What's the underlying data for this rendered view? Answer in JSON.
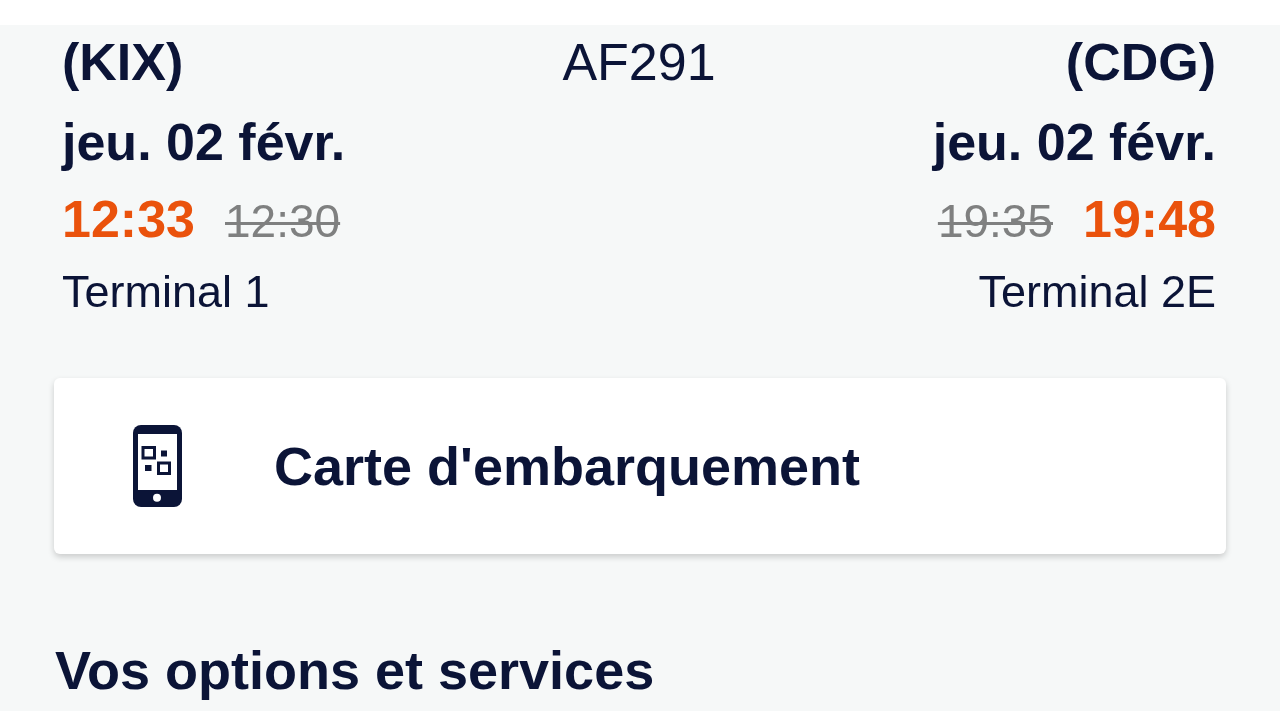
{
  "flight": {
    "origin": {
      "code": "(KIX)",
      "date": "jeu. 02 févr.",
      "times": [
        {
          "time": "12:33",
          "kind": "actual"
        },
        {
          "time": "12:30",
          "kind": "scheduled"
        }
      ],
      "terminal": "Terminal 1"
    },
    "number": "AF291",
    "destination": {
      "code": "(CDG)",
      "date": "jeu. 02 févr.",
      "times": [
        {
          "time": "19:35",
          "kind": "scheduled"
        },
        {
          "time": "19:48",
          "kind": "actual"
        }
      ],
      "terminal": "Terminal 2E"
    }
  },
  "boarding_pass": {
    "label": "Carte d'embarquement"
  },
  "section_heading": "Vos options et services"
}
